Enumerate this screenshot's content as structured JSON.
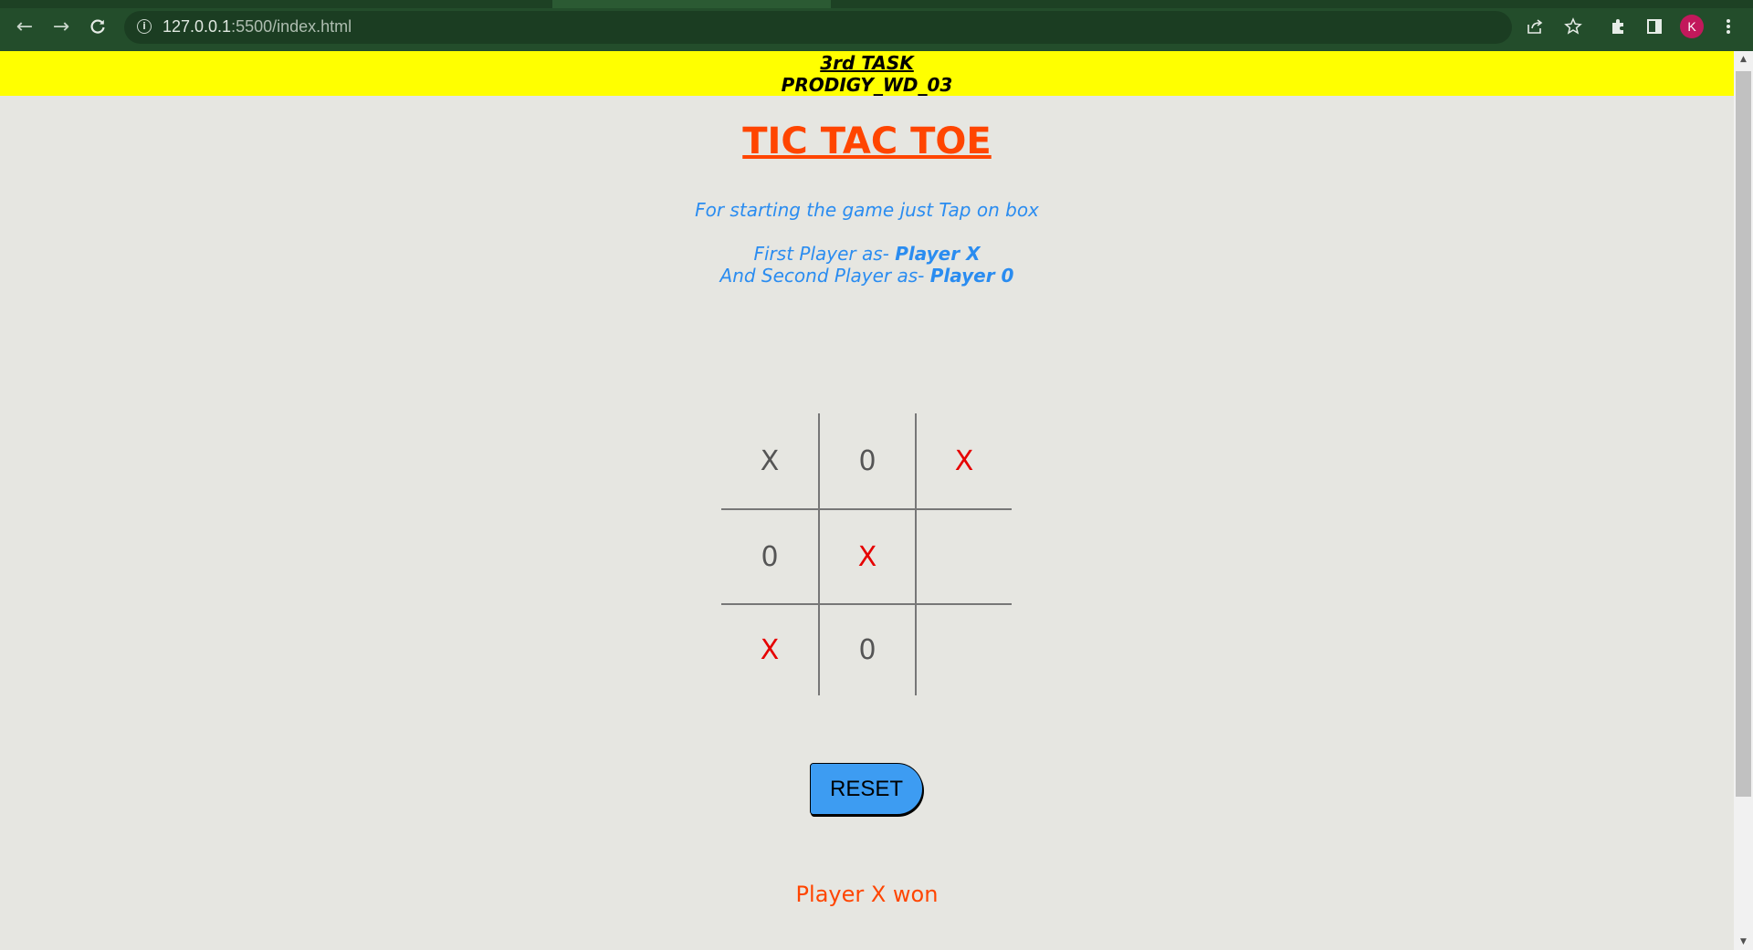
{
  "browser": {
    "url_host": "127.0.0.1",
    "url_path": ":5500/index.html",
    "avatar_letter": "K"
  },
  "banner": {
    "line1": "3rd TASK",
    "line2": "PRODIGY_WD_03"
  },
  "title": "TIC TAC TOE",
  "instructions": {
    "start": "For starting the game just Tap on box",
    "first_prefix": "First Player as- ",
    "first_player": "Player X",
    "second_prefix": "And Second Player as- ",
    "second_player": "Player 0"
  },
  "board": {
    "cells": [
      {
        "value": "X",
        "color": "#555555"
      },
      {
        "value": "0",
        "color": "#555555"
      },
      {
        "value": "X",
        "color": "#e60000"
      },
      {
        "value": "0",
        "color": "#555555"
      },
      {
        "value": "X",
        "color": "#e60000"
      },
      {
        "value": "",
        "color": "#555555"
      },
      {
        "value": "X",
        "color": "#e60000"
      },
      {
        "value": "0",
        "color": "#555555"
      },
      {
        "value": "",
        "color": "#555555"
      }
    ]
  },
  "reset_label": "RESET",
  "status": "Player X won",
  "colors": {
    "banner_bg": "#ffff00",
    "title": "#ff4500",
    "instructions": "#2a8cf0",
    "win_mark": "#e60000",
    "reset_bg": "#3d9cf2",
    "page_bg": "#e6e6e1"
  }
}
